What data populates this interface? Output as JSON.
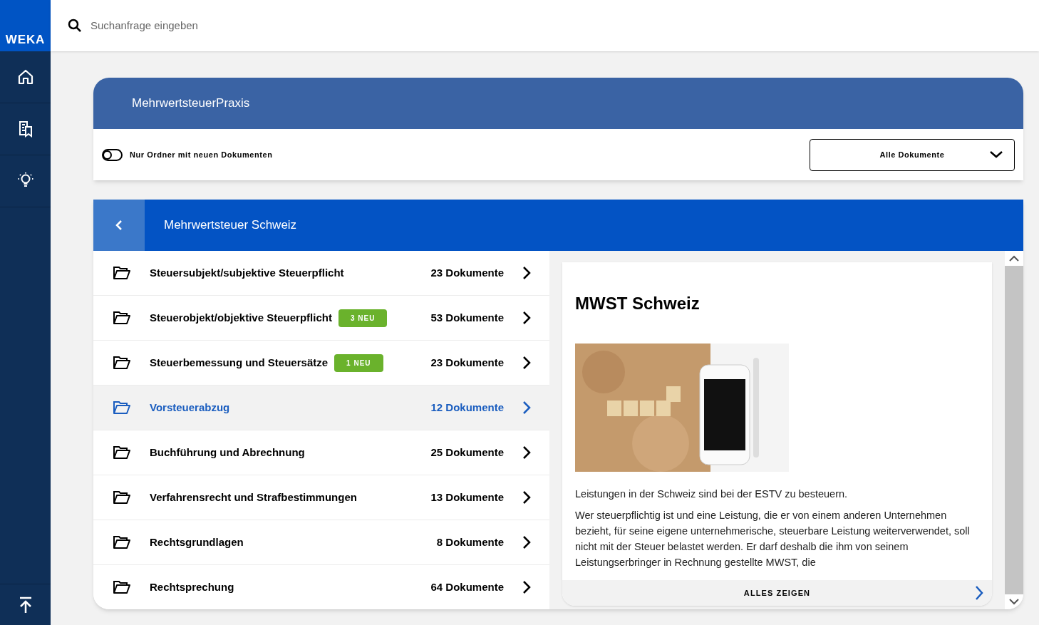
{
  "sidebar": {
    "logo": "WEKA",
    "items": [
      {
        "kind": "home"
      },
      {
        "kind": "documents"
      },
      {
        "kind": "ideas"
      }
    ]
  },
  "search": {
    "placeholder": "Suchanfrage eingeben"
  },
  "product": {
    "title": "MehrwertsteuerPraxis"
  },
  "filter": {
    "toggle_label": "Nur Ordner mit neuen Dokumenten",
    "on": false,
    "dropdown": "Alle Dokumente"
  },
  "folder": {
    "title": "Mehrwertsteuer Schweiz"
  },
  "folders": [
    {
      "name": "Steuersubjekt/subjektive Steuerpflicht",
      "count": "23 Dokumente",
      "selected": false
    },
    {
      "name": "Steuerobjekt/objektive Steuerpflicht",
      "badge": "3 NEU",
      "count": "53 Dokumente",
      "selected": false
    },
    {
      "name": "Steuerbemessung und Steuersätze",
      "badge": "1 NEU",
      "count": "23 Dokumente",
      "selected": false
    },
    {
      "name": "Vorsteuerabzug",
      "count": "12 Dokumente",
      "selected": true
    },
    {
      "name": "Buchführung und Abrechnung",
      "count": "25 Dokumente",
      "selected": false
    },
    {
      "name": "Verfahrensrecht und Strafbestimmungen",
      "count": "13 Dokumente",
      "selected": false
    },
    {
      "name": "Rechtsgrundlagen",
      "count": "8 Dokumente",
      "selected": false
    },
    {
      "name": "Rechtsprechung",
      "count": "64 Dokumente",
      "selected": false
    }
  ],
  "preview": {
    "title": "MWST Schweiz",
    "image": {
      "kind": "picture"
    },
    "paragraphs": [
      "Leistungen in der Schweiz sind bei der ESTV zu besteuern.",
      "Wer steuerpflichtig ist und eine Leistung, die er von einem anderen Unternehmen bezieht, für seine eigene unternehmerische, steuerbare Leistung weiterverwendet, soll nicht mit der Steuer belastet werden. Er darf deshalb die ihm von seinem Leistungserbringer in Rechnung gestellte MWST, die"
    ],
    "show_all": "ALLES ZEIGEN"
  }
}
